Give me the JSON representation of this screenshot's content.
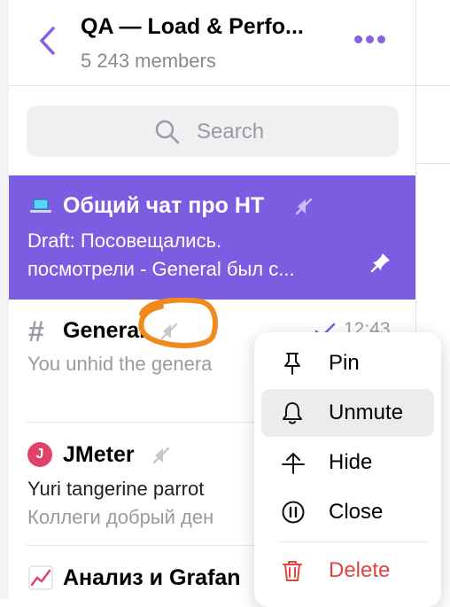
{
  "header": {
    "title": "QA — Load & Perfo...",
    "members": "5 243 members"
  },
  "search": {
    "placeholder": "Search"
  },
  "chats": [
    {
      "name": "Общий чат про НТ",
      "draft_prefix": "Draft:",
      "line1": " Посовещались.",
      "line2": "посмотрели - General был с..."
    },
    {
      "name": "General",
      "time": "12:43",
      "line1": "You unhid the genera"
    },
    {
      "name": "JMeter",
      "line1": "Yuri tangerine parrot",
      "line2": "Коллеги добрый ден"
    },
    {
      "name": "Анализ и Grafan"
    }
  ],
  "context_menu": {
    "items": [
      {
        "label": "Pin",
        "icon": "pin-icon"
      },
      {
        "label": "Unmute",
        "icon": "bell-icon"
      },
      {
        "label": "Hide",
        "icon": "hide-icon"
      },
      {
        "label": "Close",
        "icon": "pause-circle-icon"
      },
      {
        "label": "Delete",
        "icon": "trash-icon"
      }
    ]
  },
  "colors": {
    "accent": "#7c5ce0",
    "muted_text": "#9a9aa0",
    "delete": "#e0453d",
    "annotation": "#f08a1c",
    "jmeter_avatar": "#e0436a"
  }
}
